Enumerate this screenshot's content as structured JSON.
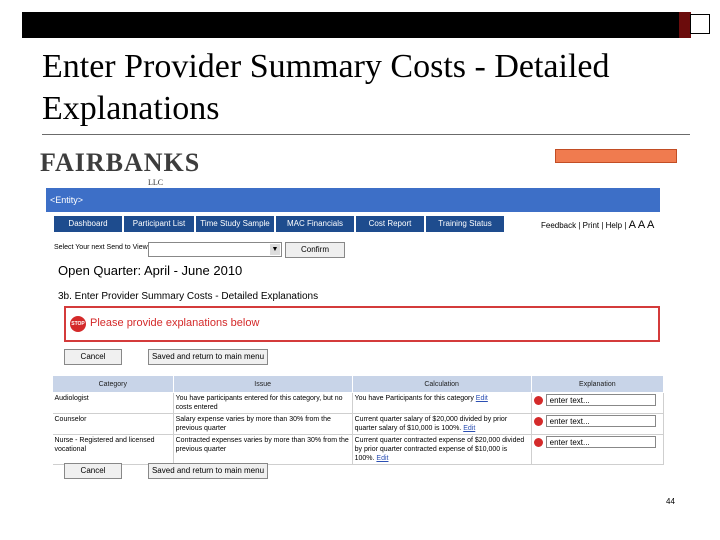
{
  "slide": {
    "title": "Enter Provider Summary Costs - Detailed Explanations",
    "page_number": "44"
  },
  "logo": {
    "name": "FAIRBANKS",
    "suffix": "LLC"
  },
  "entity_bar": {
    "label": "<Entity>"
  },
  "nav": {
    "tabs": [
      "Dashboard",
      "Participant List",
      "Time Study Sample",
      "MAC Financials",
      "Cost Report",
      "Training Status"
    ]
  },
  "links": {
    "feedback": "Feedback",
    "print": "Print",
    "help": "Help",
    "text_size": "A A A"
  },
  "select": {
    "label": "Select Your next Send to View",
    "confirm": "Confirm"
  },
  "quarter": {
    "label": "Open Quarter: April - June 2010"
  },
  "section": {
    "title": "3b. Enter Provider Summary Costs - Detailed Explanations"
  },
  "alert": {
    "text": "Please provide explanations below",
    "stop_label": "STOP"
  },
  "buttons": {
    "cancel": "Cancel",
    "save": "Saved and return to main menu"
  },
  "table": {
    "headers": [
      "Category",
      "Issue",
      "Calculation",
      "Explanation"
    ],
    "rows": [
      {
        "category": "Audiologist",
        "issue": "You have participants entered for this category, but no costs entered",
        "calc": "You have Participants for this category ",
        "calc_link": "Edit",
        "explanation": "enter text..."
      },
      {
        "category": "Counselor",
        "issue": "Salary expense varies by more than 30% from the previous quarter",
        "calc": "Current quarter salary of $20,000 divided by prior quarter salary of $10,000 is 100%. ",
        "calc_link": "Edit",
        "explanation": "enter text..."
      },
      {
        "category": "Nurse - Registered and licensed vocational",
        "issue": "Contracted expenses varies by more than 30% from the previous quarter",
        "calc": "Current quarter contracted expense of $20,000 divided by prior quarter contracted expense of $10,000 is 100%. ",
        "calc_link": "Edit",
        "explanation": "enter text..."
      }
    ]
  }
}
